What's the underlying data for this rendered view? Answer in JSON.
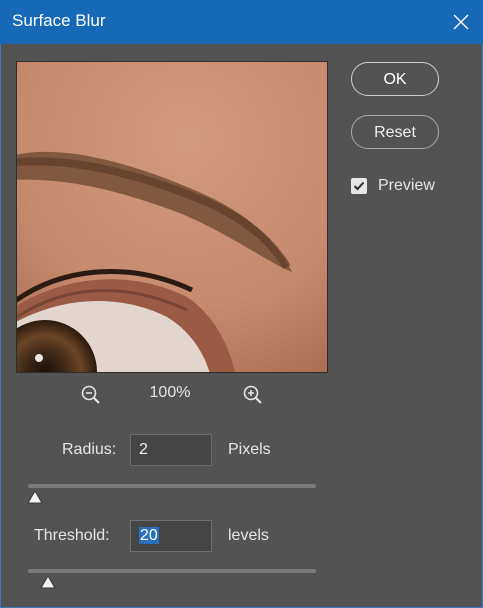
{
  "window": {
    "title": "Surface Blur"
  },
  "buttons": {
    "ok": "OK",
    "reset": "Reset"
  },
  "preview_toggle": {
    "label": "Preview",
    "checked": true
  },
  "zoom": {
    "level": "100%"
  },
  "radius": {
    "label": "Radius:",
    "value": "2",
    "unit": "Pixels",
    "slider_fraction": 0.01
  },
  "threshold": {
    "label": "Threshold:",
    "value": "20",
    "unit": "levels",
    "slider_fraction": 0.07
  },
  "icons": {
    "close": "close-icon",
    "zoom_out": "zoom-out-icon",
    "zoom_in": "zoom-in-icon",
    "check": "checkmark-icon"
  },
  "colors": {
    "titlebar": "#1868b8",
    "dialog_bg": "#535353",
    "selection": "#2a6fbe"
  }
}
